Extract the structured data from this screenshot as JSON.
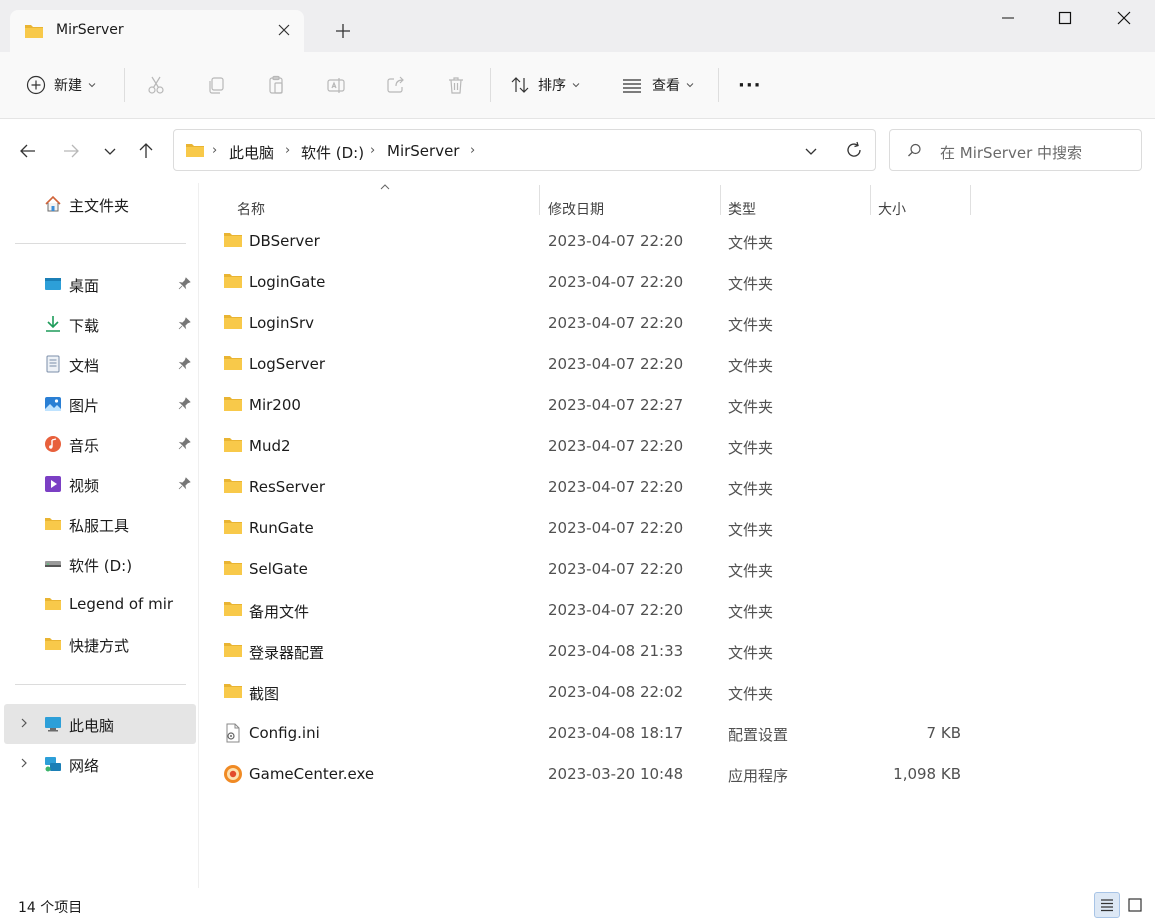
{
  "tab": {
    "title": "MirServer"
  },
  "toolbar": {
    "new_label": "新建",
    "sort_label": "排序",
    "view_label": "查看",
    "more_label": "···"
  },
  "breadcrumb": [
    "此电脑",
    "软件 (D:)",
    "MirServer"
  ],
  "search": {
    "placeholder": "在 MirServer 中搜索"
  },
  "sidebar": {
    "home": "主文件夹",
    "pinned": [
      {
        "label": "桌面",
        "icon": "desktop-icon"
      },
      {
        "label": "下载",
        "icon": "download-icon"
      },
      {
        "label": "文档",
        "icon": "document-icon"
      },
      {
        "label": "图片",
        "icon": "pictures-icon"
      },
      {
        "label": "音乐",
        "icon": "music-icon"
      },
      {
        "label": "视频",
        "icon": "video-icon"
      }
    ],
    "others": [
      {
        "label": "私服工具",
        "icon": "folder-icon"
      },
      {
        "label": "软件 (D:)",
        "icon": "drive-icon"
      },
      {
        "label": "Legend of mir",
        "icon": "folder-icon"
      },
      {
        "label": "快捷方式",
        "icon": "folder-icon"
      }
    ],
    "this_pc": "此电脑",
    "network": "网络"
  },
  "columns": {
    "name": "名称",
    "date": "修改日期",
    "type": "类型",
    "size": "大小"
  },
  "files": [
    {
      "name": "DBServer",
      "date": "2023-04-07 22:20",
      "type": "文件夹",
      "size": "",
      "icon": "folder"
    },
    {
      "name": "LoginGate",
      "date": "2023-04-07 22:20",
      "type": "文件夹",
      "size": "",
      "icon": "folder"
    },
    {
      "name": "LoginSrv",
      "date": "2023-04-07 22:20",
      "type": "文件夹",
      "size": "",
      "icon": "folder"
    },
    {
      "name": "LogServer",
      "date": "2023-04-07 22:20",
      "type": "文件夹",
      "size": "",
      "icon": "folder"
    },
    {
      "name": "Mir200",
      "date": "2023-04-07 22:27",
      "type": "文件夹",
      "size": "",
      "icon": "folder"
    },
    {
      "name": "Mud2",
      "date": "2023-04-07 22:20",
      "type": "文件夹",
      "size": "",
      "icon": "folder"
    },
    {
      "name": "ResServer",
      "date": "2023-04-07 22:20",
      "type": "文件夹",
      "size": "",
      "icon": "folder"
    },
    {
      "name": "RunGate",
      "date": "2023-04-07 22:20",
      "type": "文件夹",
      "size": "",
      "icon": "folder"
    },
    {
      "name": "SelGate",
      "date": "2023-04-07 22:20",
      "type": "文件夹",
      "size": "",
      "icon": "folder"
    },
    {
      "name": "备用文件",
      "date": "2023-04-07 22:20",
      "type": "文件夹",
      "size": "",
      "icon": "folder"
    },
    {
      "name": "登录器配置",
      "date": "2023-04-08 21:33",
      "type": "文件夹",
      "size": "",
      "icon": "folder"
    },
    {
      "name": "截图",
      "date": "2023-04-08 22:02",
      "type": "文件夹",
      "size": "",
      "icon": "folder"
    },
    {
      "name": "Config.ini",
      "date": "2023-04-08 18:17",
      "type": "配置设置",
      "size": "7 KB",
      "icon": "ini"
    },
    {
      "name": "GameCenter.exe",
      "date": "2023-03-20 10:48",
      "type": "应用程序",
      "size": "1,098 KB",
      "icon": "exe"
    }
  ],
  "status": {
    "item_count": "14 个项目"
  },
  "colors": {
    "folder": "#f8c94a",
    "folder_dark": "#e9b432",
    "accent": "#005fb8"
  }
}
